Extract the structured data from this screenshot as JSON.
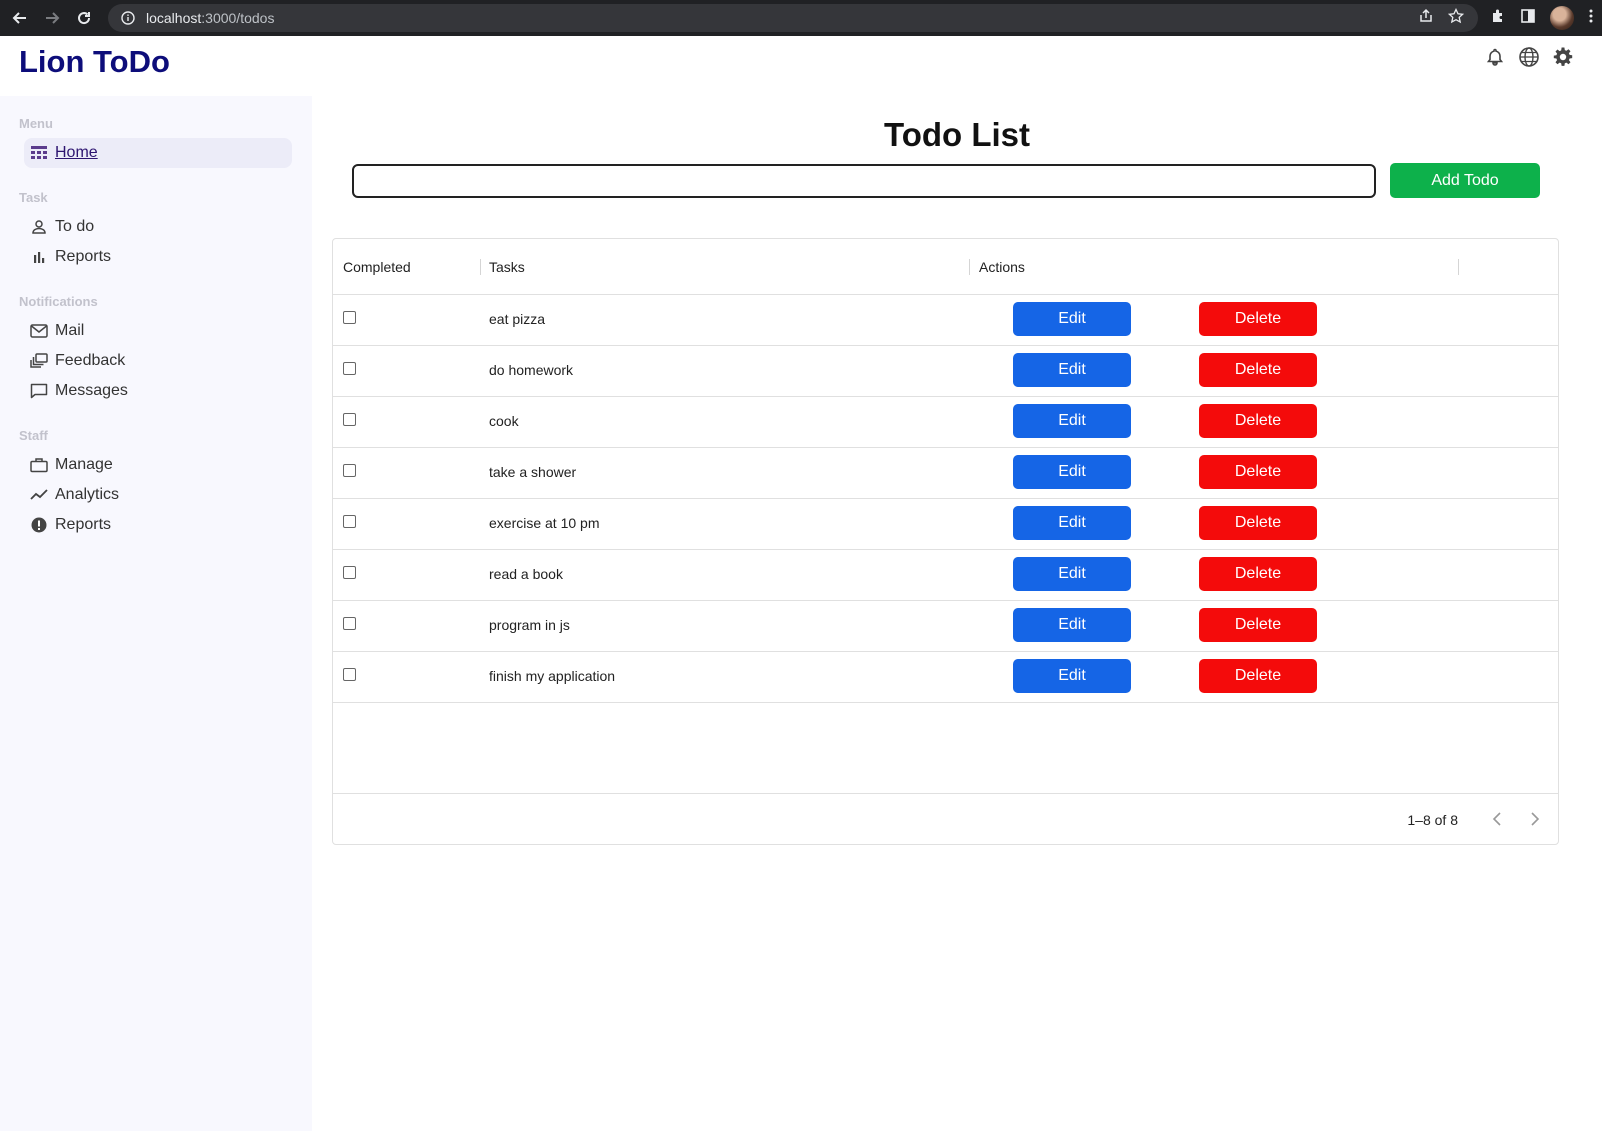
{
  "browser": {
    "url_host": "localhost",
    "url_path": ":3000/todos"
  },
  "app": {
    "brand": "Lion ToDo"
  },
  "sidebar": {
    "sections": [
      {
        "title": "Menu",
        "items": [
          {
            "label": "Home",
            "icon": "dashboard-icon",
            "active": true
          }
        ]
      },
      {
        "title": "Task",
        "items": [
          {
            "label": "To do",
            "icon": "person-icon"
          },
          {
            "label": "Reports",
            "icon": "bar-chart-icon"
          }
        ]
      },
      {
        "title": "Notifications",
        "items": [
          {
            "label": "Mail",
            "icon": "mail-icon"
          },
          {
            "label": "Feedback",
            "icon": "feedback-icon"
          },
          {
            "label": "Messages",
            "icon": "chat-icon"
          }
        ]
      },
      {
        "title": "Staff",
        "items": [
          {
            "label": "Manage",
            "icon": "briefcase-icon"
          },
          {
            "label": "Analytics",
            "icon": "trend-icon"
          },
          {
            "label": "Reports",
            "icon": "alert-icon"
          }
        ]
      }
    ]
  },
  "main": {
    "title": "Todo List",
    "input_value": "",
    "add_button": "Add Todo"
  },
  "table": {
    "columns": [
      "Completed",
      "Tasks",
      "Actions"
    ],
    "rows": [
      {
        "task": "eat pizza",
        "completed": false
      },
      {
        "task": "do homework",
        "completed": false
      },
      {
        "task": "cook",
        "completed": false
      },
      {
        "task": "take a shower",
        "completed": false
      },
      {
        "task": "exercise at 10 pm",
        "completed": false
      },
      {
        "task": "read a book",
        "completed": false
      },
      {
        "task": "program in js",
        "completed": false
      },
      {
        "task": "finish my application",
        "completed": false
      }
    ],
    "edit_label": "Edit",
    "delete_label": "Delete",
    "pagination": "1–8 of 8"
  },
  "colors": {
    "brand": "#0d0d7a",
    "add": "#0db14b",
    "edit": "#1565e6",
    "delete": "#f40b0b"
  }
}
